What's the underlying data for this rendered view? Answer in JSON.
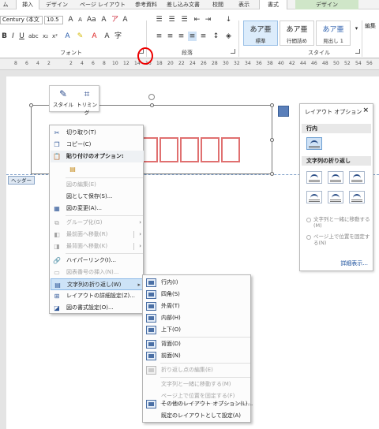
{
  "tabs": [
    "ム",
    "挿入",
    "デザイン",
    "ページ レイアウト",
    "参考資料",
    "差し込み文書",
    "校閲",
    "表示",
    "書式",
    "デザイン"
  ],
  "ribbon": {
    "font_name": "Century (本文",
    "font_size": "10.5",
    "group_font": "フォント",
    "group_paragraph": "段落",
    "group_styles": "スタイル",
    "edit_label": "編集",
    "styles": [
      {
        "sample": "あア亜",
        "name": "標準"
      },
      {
        "sample": "あア亜",
        "name": "行間詰め"
      },
      {
        "sample": "あア亜",
        "name": "見出し 1"
      }
    ]
  },
  "ruler_ticks": [
    "8",
    "6",
    "4",
    "2",
    "2",
    "4",
    "6",
    "8",
    "10",
    "12",
    "14",
    "16",
    "18",
    "20",
    "22",
    "24",
    "26",
    "28",
    "30",
    "32",
    "34",
    "36",
    "38",
    "40",
    "42",
    "44",
    "46",
    "48",
    "50",
    "52",
    "54",
    "56"
  ],
  "header_tag": "ヘッダー",
  "mini_toolbar": {
    "style": "スタイル",
    "crop": "トリミング"
  },
  "context_menu": {
    "cut": "切り取り(T)",
    "copy": "コピー(C)",
    "paste_options": "貼り付けのオプション:",
    "edit_picture": "図の編集(E)",
    "save_as_picture": "図として保存(S)...",
    "change_picture": "図の変更(A)...",
    "group": "グループ化(G)",
    "bring_front": "最前面へ移動(R)",
    "send_back": "最背面へ移動(K)",
    "hyperlink": "ハイパーリンク(I)...",
    "insert_caption": "図表番号の挿入(N)...",
    "wrap_text": "文字列の折り返し(W)",
    "more_layout": "レイアウトの詳細設定(Z)...",
    "format_picture": "図の書式設定(O)..."
  },
  "submenu": {
    "inline": "行内(I)",
    "square": "四角(S)",
    "tight": "外周(T)",
    "through": "内部(H)",
    "top_bottom": "上下(O)",
    "behind": "背面(D)",
    "in_front": "前面(N)",
    "edit_wrap_points": "折り返し点の編集(E)",
    "move_with_text": "文字列と一緒に移動する(M)",
    "fix_position": "ページ上で位置を固定する(F)",
    "more_layout_options": "その他のレイアウト オプション(L)...",
    "set_default": "既定のレイアウトとして設定(A)"
  },
  "layout_options": {
    "title": "レイアウト オプション",
    "close": "×",
    "inline_section": "行内",
    "wrap_section": "文字列の折り返し",
    "move_with_text": "文字列と一緒に移動する(M)",
    "fix_on_page": "ページ上で位置を固定する(N)",
    "see_more": "詳細表示..."
  }
}
